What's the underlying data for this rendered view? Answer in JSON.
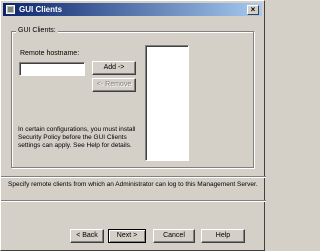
{
  "window": {
    "title": "GUI Clients",
    "close_glyph": "×"
  },
  "group": {
    "legend": "GUI Clients:",
    "hostname_label": "Remote hostname:",
    "hostname_value": "",
    "add_button": "Add ->",
    "remove_button": "<- Remove",
    "clients_list": [],
    "note": "In certain configurations, you must install Security Policy before the GUI Clients settings can apply. See Help for details."
  },
  "description": "Specify remote clients from which an Administrator can log to this Management Server.",
  "footer": {
    "back_button": "< Back",
    "next_button": "Next >",
    "cancel_button": "Cancel",
    "help_button": "Help"
  },
  "colors": {
    "title_gradient_start": "#0a246a",
    "title_gradient_end": "#a6caf0",
    "dialog_face": "#d4d0c8"
  }
}
